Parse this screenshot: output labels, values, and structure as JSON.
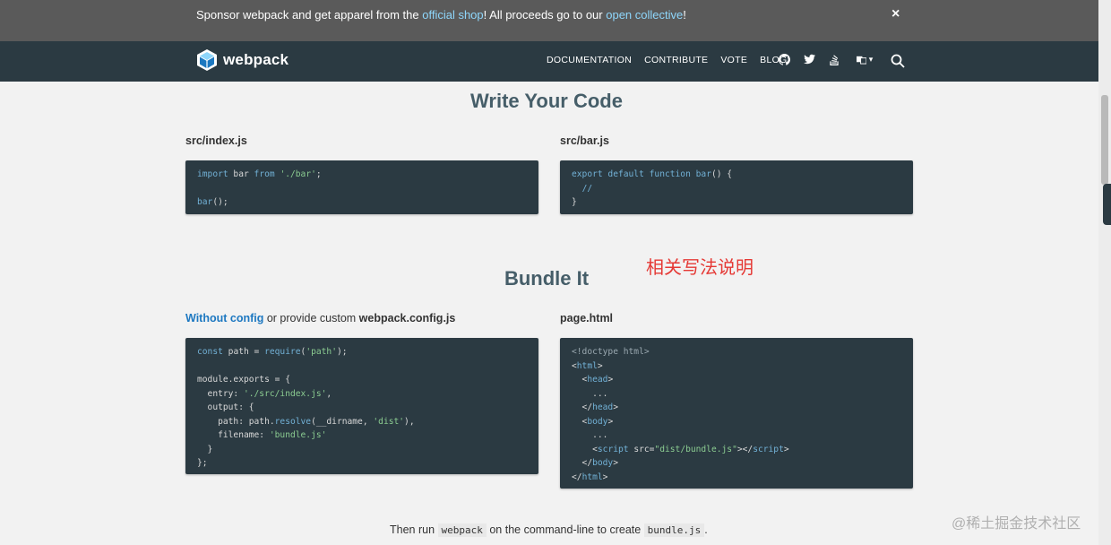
{
  "banner": {
    "text_before": "Sponsor webpack and get apparel from the ",
    "link1": "official shop",
    "text_mid": "! All proceeds go to our ",
    "link2": "open collective",
    "text_after": "!",
    "close": "×"
  },
  "nav": {
    "brand": "webpack",
    "links": [
      "DOCUMENTATION",
      "CONTRIBUTE",
      "VOTE",
      "BLOG"
    ],
    "icons": [
      "github-icon",
      "twitter-icon",
      "stack-overflow-icon",
      "language-icon",
      "search-icon"
    ],
    "language_caret": "▾"
  },
  "section1": {
    "title": "Write Your Code",
    "left_label": "src/index.js",
    "right_label": "src/bar.js"
  },
  "section2": {
    "title": "Bundle It",
    "left_label_link": "Without config",
    "left_label_plain": " or provide custom ",
    "left_label_file": "webpack.config.js",
    "right_label": "page.html"
  },
  "annotation": "相关写法说明",
  "footer": {
    "before": "Then run ",
    "cmd": "webpack",
    "mid": " on the command-line to create ",
    "file": "bundle.js",
    "after": "."
  },
  "watermark": "@稀土掘金技术社区",
  "colors": {
    "banner_bg": "#5a5a5a",
    "nav_bg": "#2b3a42",
    "link": "#8ed6fb",
    "heading": "#465e69",
    "code_bg": "#2b3a42",
    "annotation": "#e53935"
  }
}
